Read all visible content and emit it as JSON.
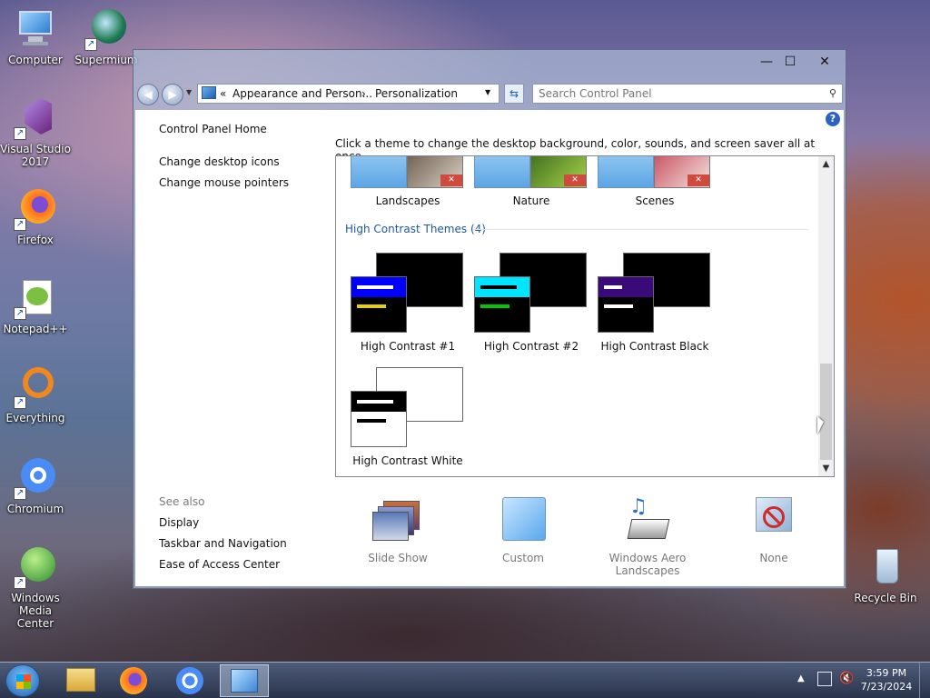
{
  "desktop": {
    "icons": [
      {
        "label": "Computer"
      },
      {
        "label": "Supermium"
      },
      {
        "label": "Visual Studio 2017"
      },
      {
        "label": "Firefox"
      },
      {
        "label": "Notepad++"
      },
      {
        "label": "Everything"
      },
      {
        "label": "Chromium"
      },
      {
        "label": "Windows Media Center"
      },
      {
        "label": "Recycle Bin"
      }
    ]
  },
  "window": {
    "controls": {
      "minimize": "—",
      "maximize": "☐",
      "close": "✕"
    },
    "breadcrumb": {
      "chevrons": "«",
      "parent": "Appearance and Person...",
      "separator": "›",
      "current": "Personalization"
    },
    "search": {
      "placeholder": "Search Control Panel"
    },
    "sidebar": {
      "home": "Control Panel Home",
      "links": [
        "Change desktop icons",
        "Change mouse pointers"
      ],
      "see_also_title": "See also",
      "see_also": [
        "Display",
        "Taskbar and Navigation",
        "Ease of Access Center"
      ]
    },
    "intro": "Click a theme to change the desktop background, color, sounds, and screen saver all at once.",
    "top_themes": [
      "Landscapes",
      "Nature",
      "Scenes"
    ],
    "high_contrast": {
      "title": "High Contrast Themes (4)",
      "themes": [
        {
          "name": "High Contrast #1",
          "accent": "#0000ff",
          "line2": "#e6d000"
        },
        {
          "name": "High Contrast #2",
          "accent": "#00e5ff",
          "line2": "#00c800"
        },
        {
          "name": "High Contrast Black",
          "accent": "#3a0a7a",
          "line2": "#ffffff"
        },
        {
          "name": "High Contrast White",
          "accent": "#000000",
          "line2": "#000000"
        }
      ]
    },
    "bottom": [
      {
        "label": "Slide Show"
      },
      {
        "label": "Custom"
      },
      {
        "label": "Windows Aero Landscapes"
      },
      {
        "label": "None"
      }
    ]
  },
  "taskbar": {
    "time": "3:59 PM",
    "date": "7/23/2024"
  }
}
